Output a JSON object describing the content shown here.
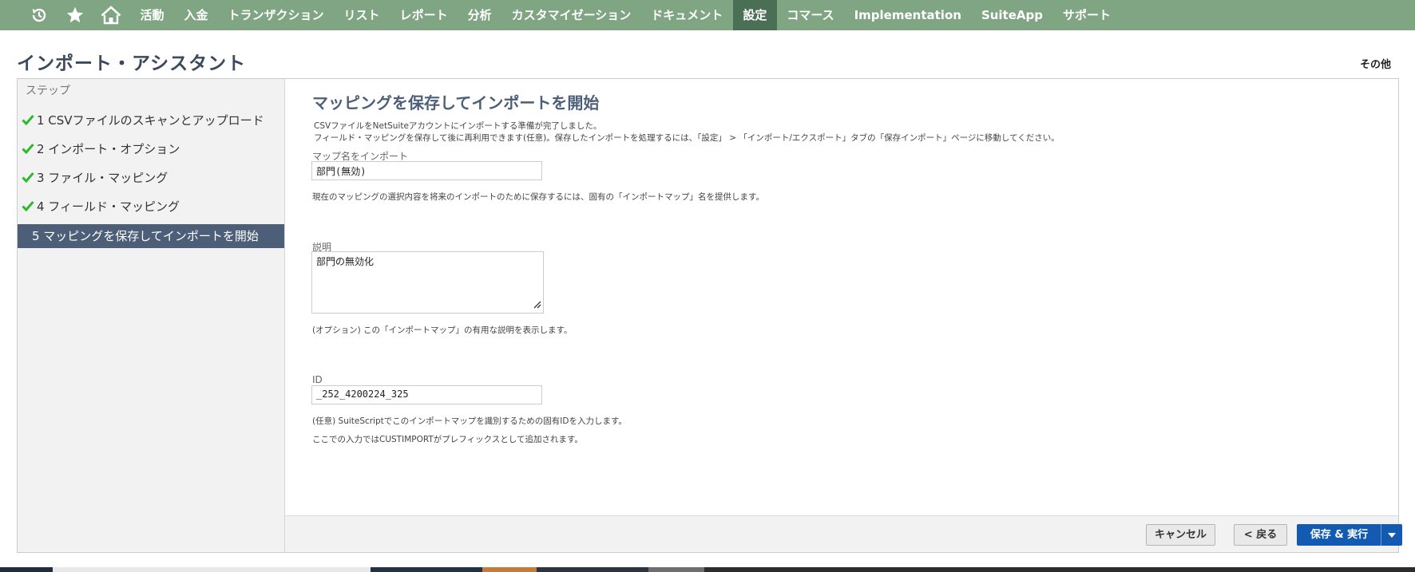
{
  "nav": {
    "icons": [
      "history-icon",
      "star-icon",
      "home-icon"
    ],
    "items": [
      "活動",
      "入金",
      "トランザクション",
      "リスト",
      "レポート",
      "分析",
      "カスタマイゼーション",
      "ドキュメント",
      "設定",
      "コマース",
      "Implementation",
      "SuiteApp",
      "サポート"
    ],
    "active": "設定"
  },
  "page": {
    "title": "インポート・アシスタント",
    "more": "その他"
  },
  "steps": {
    "header": "ステップ",
    "items": [
      {
        "label": "1 CSVファイルのスキャンとアップロード",
        "done": true
      },
      {
        "label": "2 インポート・オプション",
        "done": true
      },
      {
        "label": "3 ファイル・マッピング",
        "done": true
      },
      {
        "label": "4 フィールド・マッピング",
        "done": true
      },
      {
        "label": "5 マッピングを保存してインポートを開始",
        "current": true
      }
    ]
  },
  "main": {
    "title": "マッピングを保存してインポートを開始",
    "intro_line1": "CSVファイルをNetSuiteアカウントにインポートする準備が完了しました。",
    "intro_line2": "フィールド・マッピングを保存して後に再利用できます(任意)。保存したインポートを処理するには、「設定」 > 「インポート/エクスポート」タブの「保存インポート」ページに移動してください。",
    "map_name_label": "マップ名をインポート",
    "map_name_value": "部門(無効)",
    "map_name_help": "現在のマッピングの選択内容を将来のインポートのために保存するには、固有の「インポートマップ」名を提供します。",
    "description_label": "説明",
    "description_value": "部門の無効化",
    "description_help": "(オプション) この「インポートマップ」の有用な説明を表示します。",
    "id_label": "ID",
    "id_value": "_252_4200224_325",
    "id_help1": "(任意) SuiteScriptでこのインポートマップを識別するための固有IDを入力します。",
    "id_help2": "ここでの入力ではCUSTIMPORTがプレフィックスとして追加されます。"
  },
  "buttons": {
    "cancel": "キャンセル",
    "back": "< 戻る",
    "save_run": "保存 & 実行"
  },
  "colors": {
    "nav_bg": "#7fa583",
    "nav_active": "#4b6f55",
    "step_current": "#4d5f78",
    "primary": "#125ab2",
    "check": "#2eb82e"
  }
}
